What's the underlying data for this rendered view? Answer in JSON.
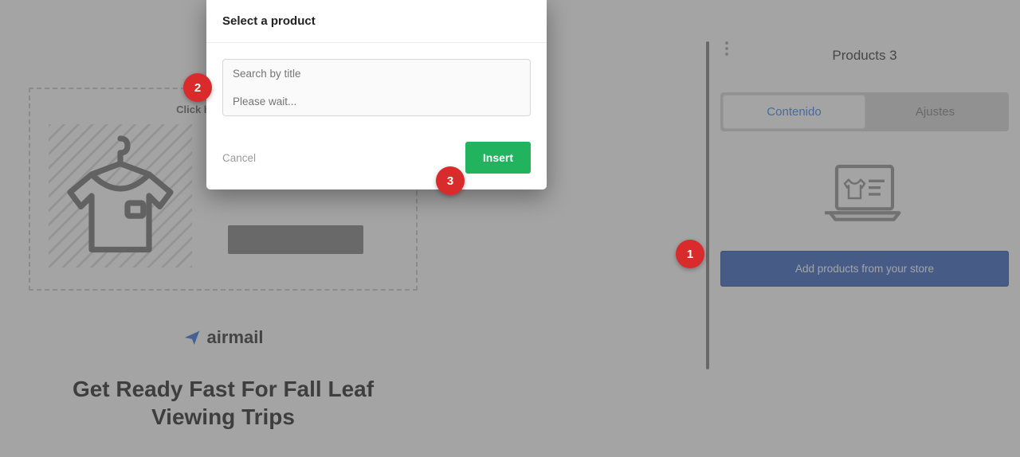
{
  "canvas": {
    "grab_text": "Click here to grab t",
    "brand_name": "airmail",
    "headline": "Get Ready Fast For Fall Leaf Viewing Trips"
  },
  "sidebar": {
    "title": "Products 3",
    "tabs": {
      "content": "Contenido",
      "settings": "Ajustes"
    },
    "add_button": "Add products from your store"
  },
  "modal": {
    "title": "Select a product",
    "search_placeholder": "Search by title",
    "loading_placeholder": "Please wait...",
    "cancel": "Cancel",
    "insert": "Insert"
  },
  "annotations": {
    "a1": "1",
    "a2": "2",
    "a3": "3"
  },
  "colors": {
    "accent_blue": "#2f80ed",
    "button_blue": "#2f5fbf",
    "badge_red": "#d92b2b",
    "insert_green": "#22b35e"
  }
}
